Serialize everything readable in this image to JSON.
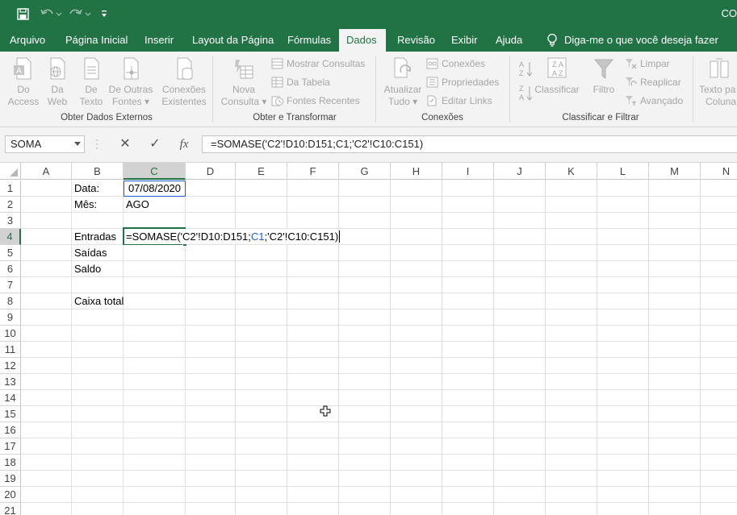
{
  "title_bar": {
    "title": "CO",
    "save_icon": "save-icon",
    "undo_icon": "undo-icon",
    "redo_icon": "redo-icon",
    "customize_icon": "customize-qat-icon"
  },
  "tabs": [
    {
      "label": "Arquivo"
    },
    {
      "label": "Página Inicial"
    },
    {
      "label": "Inserir"
    },
    {
      "label": "Layout da Página"
    },
    {
      "label": "Fórmulas"
    },
    {
      "label": "Dados"
    },
    {
      "label": "Revisão"
    },
    {
      "label": "Exibir"
    },
    {
      "label": "Ajuda"
    }
  ],
  "active_tab": "Dados",
  "tell_me": "Diga-me o que você deseja fazer",
  "ribbon": {
    "obter_dados_externos": {
      "label": "Obter Dados Externos",
      "do_access": [
        "Do",
        "Access"
      ],
      "da_web": [
        "Da",
        "Web"
      ],
      "de_texto": [
        "De",
        "Texto"
      ],
      "de_outras_fontes": [
        "De Outras",
        "Fontes ▾"
      ],
      "conexoes_existentes": [
        "Conexões",
        "Existentes"
      ]
    },
    "obter_transformar": {
      "label": "Obter e Transformar",
      "nova_consulta": [
        "Nova",
        "Consulta ▾"
      ],
      "mostrar_consultas": "Mostrar Consultas",
      "da_tabela": "Da Tabela",
      "fontes_recentes": "Fontes Recentes"
    },
    "conexoes": {
      "label": "Conexões",
      "atualizar_tudo": [
        "Atualizar",
        "Tudo ▾"
      ],
      "conexoes": "Conexões",
      "propriedades": "Propriedades",
      "editar_links": "Editar Links"
    },
    "classificar_filtrar": {
      "label": "Classificar e Filtrar",
      "classificar": "Classificar",
      "filtro": "Filtro",
      "limpar": "Limpar",
      "reaplicar": "Reaplicar",
      "avancado": "Avançado"
    },
    "ferramentas": {
      "texto_para_colunas": [
        "Texto pa",
        "Coluna"
      ]
    }
  },
  "formula_bar": {
    "name_box": "SOMA",
    "cancel": "✕",
    "enter": "✓",
    "fx": "fx",
    "formula": "=SOMASE('C2'!D10:D151;C1;'C2'!C10:C151)"
  },
  "grid": {
    "columns": [
      "A",
      "B",
      "C",
      "D",
      "E",
      "F",
      "G",
      "H",
      "I",
      "J",
      "K",
      "L",
      "M",
      "N"
    ],
    "rows": [
      "1",
      "2",
      "3",
      "4",
      "5",
      "6",
      "7",
      "8",
      "9",
      "10",
      "11",
      "12",
      "13",
      "14",
      "15",
      "16",
      "17",
      "18",
      "19",
      "20",
      "21"
    ],
    "selected_column": "C",
    "selected_row": "4",
    "cells": {
      "B1": "Data:",
      "C1": "07/08/2020",
      "B2": "Mês:",
      "C2": "AGO",
      "B4": "Entradas",
      "B5": "Saídas",
      "B6": "Saldo",
      "B8": "Caixa total"
    },
    "editing": {
      "part1": "=SOMASE('C2'!D10:D151;",
      "ref": "C1",
      "part2": ";'C2'!C10:C151)"
    }
  },
  "colors": {
    "accent": "#217346",
    "reference": "#1f5fcf"
  }
}
